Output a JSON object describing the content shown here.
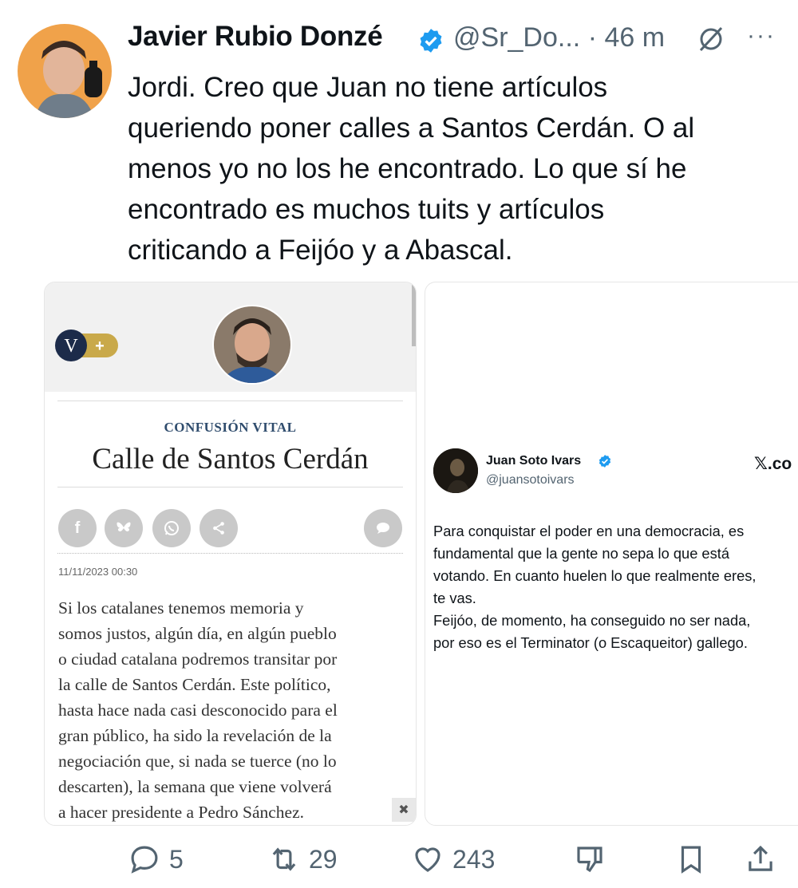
{
  "tweet": {
    "author_name": "Javier Rubio Donzé",
    "handle": "@Sr_Do...",
    "separator": "·",
    "time": "46 m",
    "more_label": "···",
    "text_lines": [
      "Jordi. Creo que Juan no tiene artículos",
      "queriendo poner calles a Santos Cerdán. O al",
      "menos yo no los he encontrado. Lo que sí he",
      "encontrado es muchos tuits y artículos",
      "criticando a Feijóo y a Abascal."
    ]
  },
  "article_card": {
    "logo_letter": "V",
    "logo_plus": "+",
    "kicker": "CONFUSIÓN VITAL",
    "headline": "Calle de Santos Cerdán",
    "share_icons": [
      "facebook-icon",
      "bluesky-icon",
      "whatsapp-icon",
      "share-icon",
      "comment-icon"
    ],
    "facebook_glyph": "f",
    "date": "11/11/2023 00:30",
    "body_lines": [
      "Si los catalanes tenemos memoria y",
      "somos justos, algún día, en algún pueblo",
      "o ciudad catalana podremos transitar por",
      "la calle de Santos Cerdán. Este político,",
      "hasta hace nada casi desconocido para el",
      "gran público, ha sido la revelación de la",
      "negociación que, si nada se tuerce (no lo",
      "descarten), la semana que viene volverá",
      "a hacer presidente a Pedro Sánchez."
    ],
    "close_label": "✖"
  },
  "embedded_tweet": {
    "name": "Juan Soto Ivars",
    "handle": "@juansotoivars",
    "source": "𝕏.co",
    "text_lines": [
      "Para conquistar el poder en una democracia, es",
      "fundamental que la gente no sepa lo que está",
      "votando. En cuanto huelen lo que realmente eres,",
      "te vas.",
      "Feijóo, de momento, ha conseguido no ser nada,",
      "por eso es el Terminator (o Escaqueitor) gallego."
    ]
  },
  "actions": {
    "replies": "5",
    "retweets": "29",
    "likes": "243"
  },
  "colors": {
    "verified": "#1d9bf0",
    "secondary_text": "#536471",
    "kicker": "#2f4c6d",
    "logo_navy": "#1c2b4a",
    "logo_gold": "#c9a94a"
  }
}
